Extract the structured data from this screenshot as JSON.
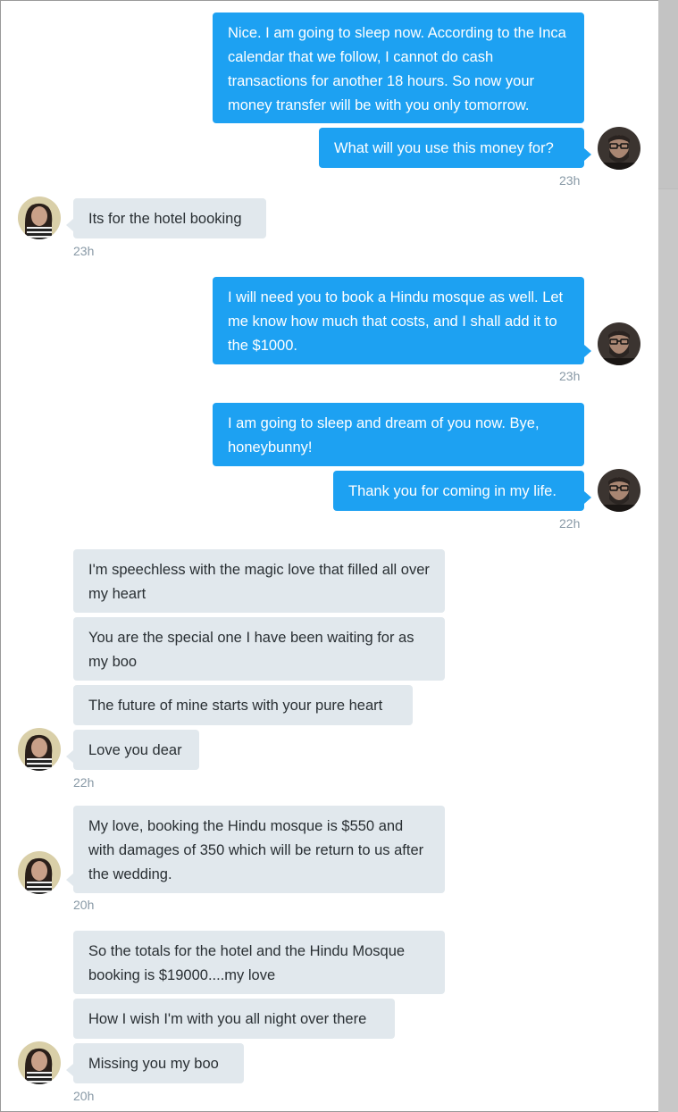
{
  "messages": [
    {
      "text": "Nice. I am going to sleep now. According to the Inca calendar that we follow, I cannot do cash transactions for another 18 hours. So now your money transfer will be with you only tomorrow."
    },
    {
      "text": "What will you use this money for?"
    },
    {
      "text": "Its for the hotel booking"
    },
    {
      "text": "I will need you to book a Hindu mosque as well. Let me know how much that costs, and I shall add it to the $1000."
    },
    {
      "text": "I am going to sleep and dream of you now. Bye, honeybunny!"
    },
    {
      "text": "Thank you for coming in my life."
    },
    {
      "text": "I'm speechless with the magic love that filled all over my heart"
    },
    {
      "text": "You are the special one I have been waiting for as my boo"
    },
    {
      "text": "The future of mine starts with your pure heart"
    },
    {
      "text": "Love you dear"
    },
    {
      "text": "My love, booking the Hindu mosque is $550 and with damages of 350 which will be return to us after the wedding."
    },
    {
      "text": "So the totals for the hotel and the Hindu Mosque booking is $19000....my love"
    },
    {
      "text": "How I wish I'm with you all night over there"
    },
    {
      "text": "Missing you my boo"
    }
  ],
  "timestamps": [
    "23h",
    "23h",
    "23h",
    "22h",
    "22h",
    "20h",
    "20h"
  ],
  "colors": {
    "sent_bubble": "#1da1f2",
    "received_bubble": "#e1e8ed",
    "timestamp": "#8899a6"
  },
  "icons": {
    "man_avatar": "bearded-man-avatar",
    "woman_avatar": "woman-avatar"
  }
}
